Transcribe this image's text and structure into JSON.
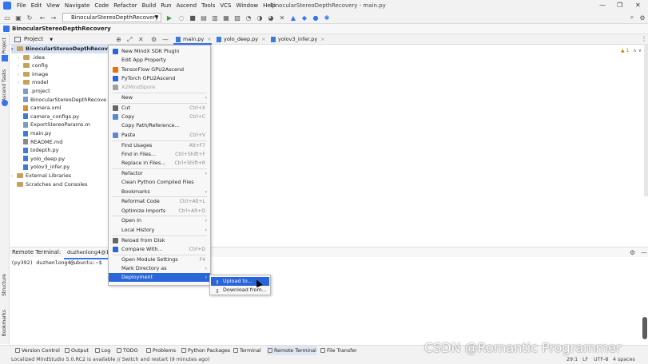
{
  "menubar": {
    "items": [
      "File",
      "Edit",
      "View",
      "Navigate",
      "Code",
      "Refactor",
      "Build",
      "Run",
      "Ascend",
      "Tools",
      "VCS",
      "Window",
      "Help"
    ],
    "window_title": "BinocularStereoDepthRecovery - main.py",
    "controls": [
      "—",
      "❐",
      "✕"
    ]
  },
  "toolbar": {
    "run_config": "BinocularStereoDepthRecovery"
  },
  "breadcrumb": {
    "project": "BinocularStereoDepthRecovery"
  },
  "left_strip": {
    "project_label": "Project",
    "ascend_tasks_label": "Ascend Tasks",
    "structure_label": "Structure",
    "bookmarks_label": "Bookmarks"
  },
  "project_panel": {
    "header": "Project"
  },
  "tree": [
    {
      "label": "BinocularStereoDepthRecovery",
      "kind": "root",
      "caret": "▾"
    },
    {
      "label": ".idea",
      "kind": "folder",
      "caret": "›"
    },
    {
      "label": "config",
      "kind": "folder",
      "caret": "›"
    },
    {
      "label": "image",
      "kind": "folder",
      "caret": "›"
    },
    {
      "label": "model",
      "kind": "folder",
      "caret": "›"
    },
    {
      "label": ".project",
      "kind": "file",
      "caret": ""
    },
    {
      "label": "BinocularStereoDepthRecove",
      "kind": "file",
      "caret": ""
    },
    {
      "label": "camera.xml",
      "kind": "xml",
      "caret": ""
    },
    {
      "label": "camera_configs.py",
      "kind": "py",
      "caret": ""
    },
    {
      "label": "ExportStereoParams.m",
      "kind": "file",
      "caret": ""
    },
    {
      "label": "main.py",
      "kind": "py",
      "caret": ""
    },
    {
      "label": "README.md",
      "kind": "md",
      "caret": ""
    },
    {
      "label": "todepth.py",
      "kind": "py",
      "caret": ""
    },
    {
      "label": "yolo_deep.py",
      "kind": "py",
      "caret": ""
    },
    {
      "label": "yolov3_infer.py",
      "kind": "py",
      "caret": ""
    },
    {
      "label": "External Libraries",
      "kind": "lib",
      "caret": "›"
    },
    {
      "label": "Scratches and Consoles",
      "kind": "lib",
      "caret": ""
    }
  ],
  "editor_tabs": [
    {
      "label": "main.py",
      "close": "×"
    },
    {
      "label": "yolo_deep.py",
      "close": "×"
    },
    {
      "label": "yolov3_infer.py",
      "close": "×"
    }
  ],
  "editor": {
    "warning_count": "1",
    "up": "∧",
    "down": "∨"
  },
  "terminal": {
    "label": "Remote Terminal:",
    "tab": "duzhenlong4@19...",
    "line": "(py392) duzhenlong4@ubuntu:~$"
  },
  "context_menu": {
    "items": [
      {
        "label": "New MindX SDK Plugin",
        "shortcut": "",
        "submenu": false,
        "disabled": false,
        "icon": "mindx-icon"
      },
      {
        "label": "Edit App Property",
        "shortcut": "",
        "submenu": false,
        "disabled": false,
        "icon": ""
      },
      {
        "label": "TensorFlow GPU2Ascend",
        "shortcut": "",
        "submenu": false,
        "disabled": false,
        "icon": "tensorflow-icon"
      },
      {
        "label": "PyTorch GPU2Ascend",
        "shortcut": "",
        "submenu": false,
        "disabled": false,
        "icon": "pytorch-icon"
      },
      {
        "label": "X2MindSpore",
        "shortcut": "",
        "submenu": false,
        "disabled": true,
        "icon": "mindspore-icon"
      },
      {
        "label": "New",
        "shortcut": "",
        "submenu": true,
        "disabled": false,
        "icon": ""
      },
      {
        "label": "Cut",
        "shortcut": "Ctrl+X",
        "submenu": false,
        "disabled": false,
        "icon": "scissors-icon"
      },
      {
        "label": "Copy",
        "shortcut": "Ctrl+C",
        "submenu": false,
        "disabled": false,
        "icon": "copy-icon"
      },
      {
        "label": "Copy Path/Reference...",
        "shortcut": "",
        "submenu": false,
        "disabled": false,
        "icon": ""
      },
      {
        "label": "Paste",
        "shortcut": "Ctrl+V",
        "submenu": false,
        "disabled": false,
        "icon": "paste-icon"
      },
      {
        "label": "Find Usages",
        "shortcut": "Alt+F7",
        "submenu": false,
        "disabled": false,
        "icon": ""
      },
      {
        "label": "Find in Files...",
        "shortcut": "Ctrl+Shift+F",
        "submenu": false,
        "disabled": false,
        "icon": ""
      },
      {
        "label": "Replace in Files...",
        "shortcut": "Ctrl+Shift+R",
        "submenu": false,
        "disabled": false,
        "icon": ""
      },
      {
        "label": "Refactor",
        "shortcut": "",
        "submenu": true,
        "disabled": false,
        "icon": ""
      },
      {
        "label": "Clean Python Compiled Files",
        "shortcut": "",
        "submenu": false,
        "disabled": false,
        "icon": ""
      },
      {
        "label": "Bookmarks",
        "shortcut": "",
        "submenu": true,
        "disabled": false,
        "icon": ""
      },
      {
        "label": "Reformat Code",
        "shortcut": "Ctrl+Alt+L",
        "submenu": false,
        "disabled": false,
        "icon": ""
      },
      {
        "label": "Optimize Imports",
        "shortcut": "Ctrl+Alt+O",
        "submenu": false,
        "disabled": false,
        "icon": ""
      },
      {
        "label": "Open In",
        "shortcut": "",
        "submenu": true,
        "disabled": false,
        "icon": ""
      },
      {
        "label": "Local History",
        "shortcut": "",
        "submenu": true,
        "disabled": false,
        "icon": ""
      },
      {
        "label": "Reload from Disk",
        "shortcut": "",
        "submenu": false,
        "disabled": false,
        "icon": "reload-icon"
      },
      {
        "label": "Compare With...",
        "shortcut": "Ctrl+D",
        "submenu": false,
        "disabled": false,
        "icon": "compare-icon"
      },
      {
        "label": "Open Module Settings",
        "shortcut": "F4",
        "submenu": false,
        "disabled": false,
        "icon": ""
      },
      {
        "label": "Mark Directory as",
        "shortcut": "",
        "submenu": true,
        "disabled": false,
        "icon": ""
      },
      {
        "label": "Deployment",
        "shortcut": "",
        "submenu": true,
        "disabled": false,
        "icon": "",
        "highlighted": true
      }
    ]
  },
  "deployment_submenu": {
    "items": [
      {
        "label": "Upload to...",
        "icon": "upload-icon",
        "highlighted": true
      },
      {
        "label": "Download from...",
        "icon": "download-icon",
        "highlighted": false
      }
    ]
  },
  "bottom_tabs": [
    {
      "label": "Version Control",
      "icon": "branch-icon"
    },
    {
      "label": "Output",
      "icon": "output-icon"
    },
    {
      "label": "Log",
      "icon": "log-icon"
    },
    {
      "label": "TODO",
      "icon": "list-icon"
    },
    {
      "label": "Problems",
      "icon": "problems-icon"
    },
    {
      "label": "Python Packages",
      "icon": "packages-icon"
    },
    {
      "label": "Terminal",
      "icon": "terminal-icon"
    },
    {
      "label": "Remote Terminal",
      "icon": "remote-terminal-icon",
      "active": true
    },
    {
      "label": "File Transfer",
      "icon": "file-transfer-icon"
    }
  ],
  "statusbar": {
    "message": "Localized MindStudio 5.0.RC2 is available // Switch and restart (9 minutes ago)",
    "position": "29:1",
    "line_sep": "LF",
    "encoding": "UTF-8",
    "indent": "4 spaces"
  },
  "watermark": "CSDN @Romantic Programmer",
  "colors": {
    "accent": "#2a65d9",
    "selection": "#d5e1f5",
    "folder": "#c9a25a"
  }
}
